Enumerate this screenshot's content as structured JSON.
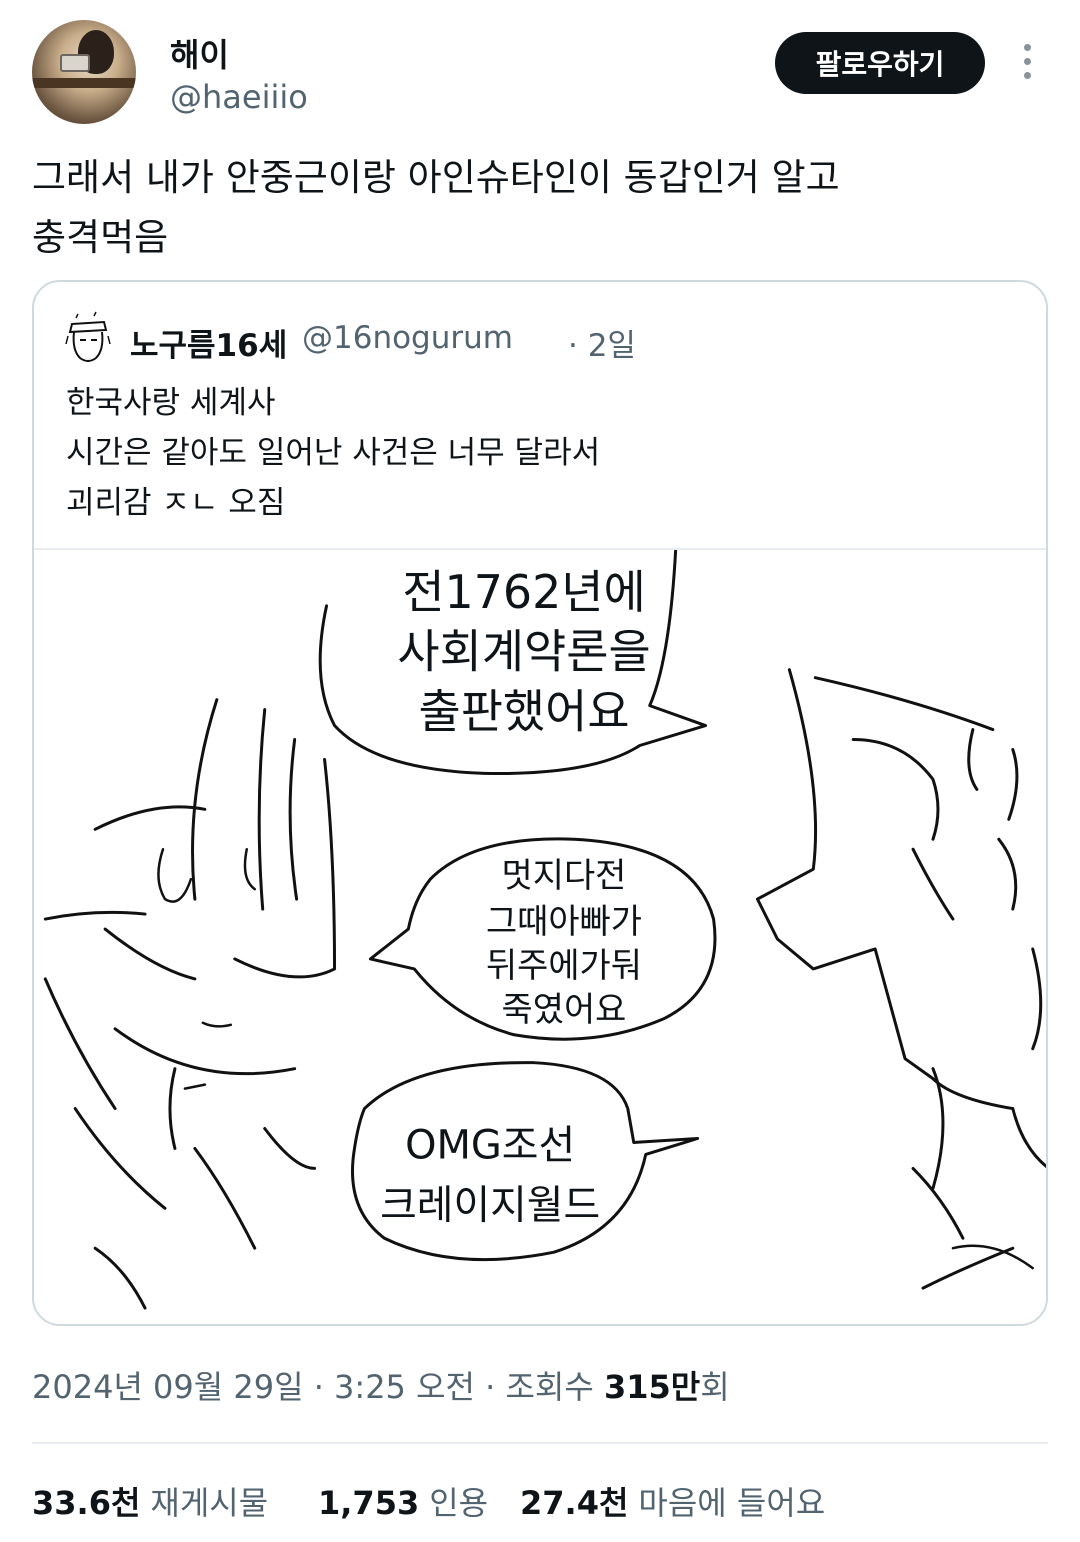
{
  "author": {
    "display_name": "해이",
    "handle": "@haeiiio",
    "follow_label": "팔로우하기"
  },
  "tweet": {
    "text_lines": [
      "그래서 내가 안중근이랑 아인슈타인이 동갑인거 알고",
      "충격먹음"
    ]
  },
  "quote": {
    "display_name": "노구름16세",
    "handle": "@16nogurum",
    "time": "· 2일",
    "text_lines": [
      "한국사랑 세계사",
      "시간은 같아도 일어난 사건은 너무 달라서",
      "괴리감 ㅈㄴ 오짐"
    ],
    "image": {
      "bubble1": [
        "전1762년에",
        "사회계약론을",
        "출판했어요"
      ],
      "bubble2": [
        "멋지다전",
        "그때아빠가",
        "뒤주에가둬",
        "죽였어요"
      ],
      "bubble3": [
        "OMG조선",
        "크레이지월드"
      ]
    }
  },
  "meta": {
    "date": "2024년 09월 29일 · 3:25 오전 · 조회수 ",
    "views": "315만",
    "views_suffix": "회"
  },
  "stats": {
    "retweets_num": "33.6천",
    "retweets_label": "재게시물",
    "quotes_num": "1,753",
    "quotes_label": "인용",
    "likes_num": "27.4천",
    "likes_label": "마음에 들어요"
  },
  "icons": {
    "more": "more-vertical-icon"
  }
}
